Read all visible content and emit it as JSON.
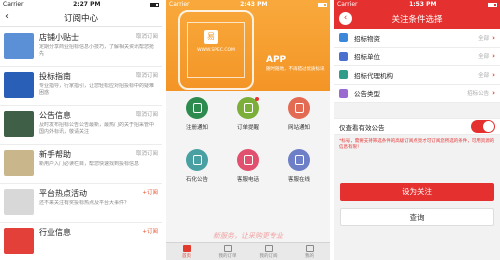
{
  "phone1": {
    "status": {
      "carrier": "Carrier",
      "time": "2:27 PM"
    },
    "nav": {
      "back_glyph": "‹",
      "title": "订阅中心"
    },
    "items": [
      {
        "title": "店铺小贴士",
        "desc": "定期分享商业招标信息小技巧，了解相关资讯帮您抢先",
        "action": "取消订阅",
        "thumb": "#5b8fd6"
      },
      {
        "title": "投标指南",
        "desc": "专业指导，行家指引，让您轻松应对招投标中的疑难困惑",
        "action": "取消订阅",
        "thumb": "#2a5fb8"
      },
      {
        "title": "公告信息",
        "desc": "及时发布招标公告公告最新，最热门的关于招采管中国内外标讯，敬请关注",
        "action": "取消订阅",
        "thumb": "#3f5f47"
      },
      {
        "title": "新手帮助",
        "desc": "新用户入门必读栏目，帮您快速找到投标信息",
        "action": "取消订阅",
        "thumb": "#c9b68a"
      },
      {
        "title": "平台热点活动",
        "desc": "还不来关注有奖投标热点及平台大事件？",
        "action": "+订阅",
        "thumb": "#d8d8d8"
      },
      {
        "title": "行业信息",
        "desc": "",
        "action": "+订阅",
        "thumb": "#e3403a"
      }
    ]
  },
  "phone2": {
    "status": {
      "carrier": "Carrier",
      "time": "2:43 PM"
    },
    "banner": {
      "logo_glyph": "易",
      "site": "WWW.SPEC.COM",
      "app_title": "APP",
      "app_sub": "随时随地，不再错过优质标讯"
    },
    "grid": [
      {
        "label": "注册通知",
        "color": "#2e8b4f"
      },
      {
        "label": "订单提醒",
        "color": "#7cae3a",
        "badge": true
      },
      {
        "label": "网站通知",
        "color": "#e36b53"
      },
      {
        "label": "石化公告",
        "color": "#49a0a2"
      },
      {
        "label": "客服电话",
        "color": "#e1506e"
      },
      {
        "label": "客服在线",
        "color": "#6d7fc6"
      }
    ],
    "slogan": "新服务，让采购更专业",
    "tabs": [
      {
        "label": "首页",
        "active": true
      },
      {
        "label": "我的订单",
        "active": false
      },
      {
        "label": "我的订阅",
        "active": false
      },
      {
        "label": "我的",
        "active": false
      }
    ]
  },
  "phone3": {
    "status": {
      "carrier": "Carrier",
      "time": "1:53 PM"
    },
    "nav": {
      "back_glyph": "‹",
      "title": "关注条件选择"
    },
    "conditions": [
      {
        "label": "招标物资",
        "value": "全部",
        "color": "#3b87d9"
      },
      {
        "label": "招标单位",
        "value": "全部",
        "color": "#4a6fcf"
      },
      {
        "label": "招标代理机构",
        "value": "全部",
        "color": "#2f9d8a"
      },
      {
        "label": "公告类型",
        "value": "招标公告",
        "color": "#9b6ad1"
      }
    ],
    "valid_label": "仅查看有效公告",
    "note": "*标号，需要支持筛选条件的高级订阅点亮才可订阅您所选的条件，可用资源的信息有限！",
    "primary_button": "设为关注",
    "secondary_button": "查询"
  }
}
